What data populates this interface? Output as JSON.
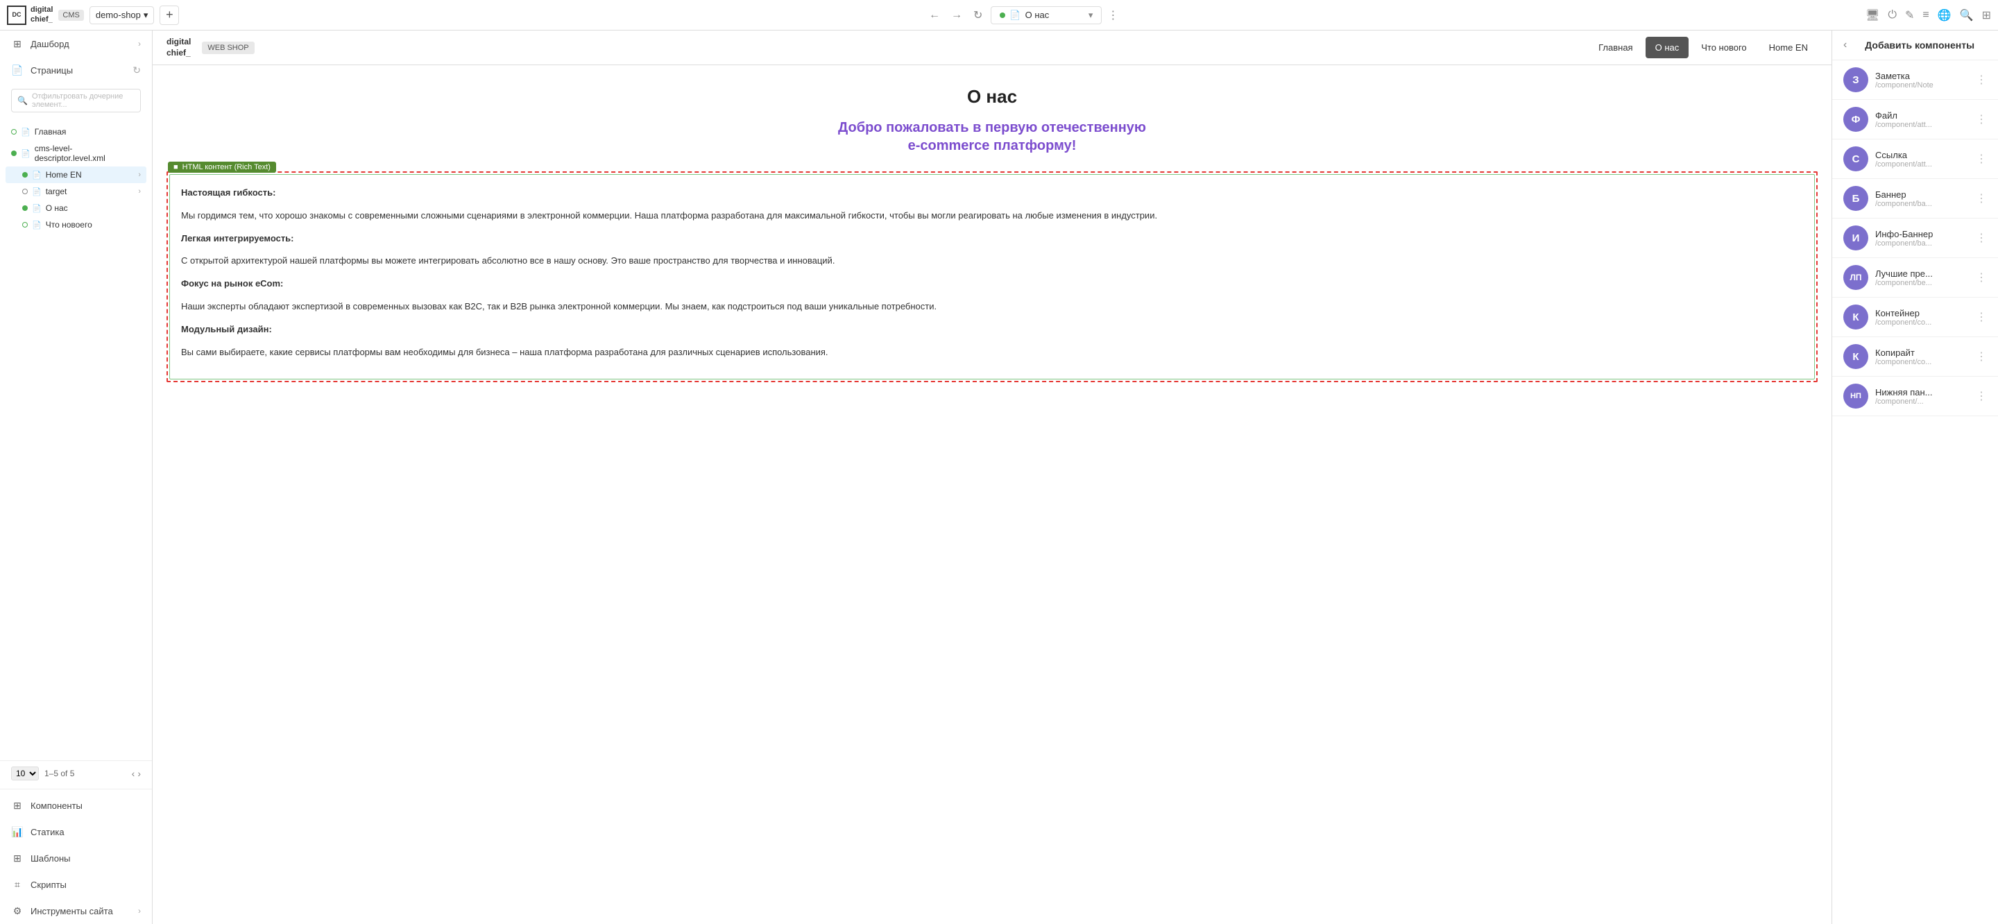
{
  "topbar": {
    "logo_line1": "digital",
    "logo_line2": "chief_",
    "cms_label": "CMS",
    "shop_name": "demo-shop",
    "add_btn_label": "+",
    "page_status_label": "О нас",
    "nav_icons": [
      "⏻",
      "✎",
      "≡",
      "🌐",
      "🔍",
      "⊞"
    ]
  },
  "left_sidebar": {
    "nav_items": [
      {
        "id": "dashboard",
        "icon": "⊞",
        "label": "Дашборд",
        "has_arrow": true
      },
      {
        "id": "pages",
        "icon": "📄",
        "label": "Страницы",
        "has_refresh": true
      }
    ],
    "filter_placeholder": "Отфильтровать дочерние элемент...",
    "tree": [
      {
        "id": "main",
        "type": "edit",
        "icon": "📄",
        "label": "Главная",
        "indent": 0,
        "selected": false
      },
      {
        "id": "cms-descriptor",
        "type": "green",
        "icon": "📄",
        "label": "cms-level-descriptor.level.xml",
        "indent": 0,
        "selected": false
      },
      {
        "id": "home-en",
        "type": "green",
        "icon": "📄",
        "label": "Home EN",
        "indent": 1,
        "has_arrow": true,
        "selected": true
      },
      {
        "id": "target",
        "type": "outline",
        "icon": "📄",
        "label": "target",
        "indent": 1,
        "has_arrow": true,
        "selected": false
      },
      {
        "id": "o-nas",
        "type": "green",
        "icon": "📄",
        "label": "О нас",
        "indent": 1,
        "selected": false
      },
      {
        "id": "chto-novogo",
        "type": "edit",
        "icon": "📄",
        "label": "Что новоего",
        "indent": 1,
        "selected": false
      }
    ],
    "pagination": {
      "per_page": "10",
      "range": "1–5 of 5"
    },
    "other_nav": [
      {
        "id": "components",
        "icon": "⊞",
        "label": "Компоненты"
      },
      {
        "id": "statika",
        "icon": "📊",
        "label": "Статика"
      },
      {
        "id": "shablony",
        "icon": "⊞",
        "label": "Шаблоны"
      },
      {
        "id": "skripty",
        "icon": "⌗",
        "label": "Скрипты"
      },
      {
        "id": "instrumenty",
        "icon": "⚙",
        "label": "Инструменты сайта",
        "has_arrow": true
      }
    ]
  },
  "preview": {
    "logo_line1": "digital",
    "logo_line2": "chief_",
    "web_shop_label": "WEB SHOP",
    "nav_links": [
      {
        "id": "glavnaya",
        "label": "Главная",
        "active": false
      },
      {
        "id": "o-nas",
        "label": "О нас",
        "active": true
      },
      {
        "id": "chto-novogo",
        "label": "Что нового",
        "active": false
      },
      {
        "id": "home-en",
        "label": "Home EN",
        "active": false
      }
    ],
    "page_title": "О нас",
    "subtitle_line1": "Добро пожаловать в первую отечественную",
    "subtitle_line2": "e-commerce платформу!",
    "component_tag": "HTML контент (Rich Text)",
    "content_blocks": [
      {
        "heading": "Настоящая гибкость:",
        "text": "Мы гордимся тем, что хорошо знакомы с современными сложными сценариями в электронной коммерции. Наша платформа разработана для максимальной гибкости, чтобы вы могли реагировать на любые изменения в индустрии."
      },
      {
        "heading": "Легкая интегрируемость:",
        "text": "С открытой архитектурой нашей платформы вы можете интегрировать абсолютно все в нашу основу. Это ваше пространство для творчества и инноваций."
      },
      {
        "heading": "Фокус на рынок eCom:",
        "text": "Наши эксперты обладают экспертизой в современных вызовах как B2C, так и B2B рынка электронной коммерции. Мы знаем, как подстроиться под ваши уникальные потребности."
      },
      {
        "heading": "Модульный дизайн:",
        "text": "Вы сами выбираете, какие сервисы платформы вам необходимы для бизнеса – наша платформа разработана для различных сценариев использования."
      }
    ]
  },
  "right_sidebar": {
    "back_icon": "‹",
    "title": "Добавить компоненты",
    "components": [
      {
        "id": "zametka",
        "initial": "З",
        "color": "#7c6fcd",
        "name": "Заметка",
        "path": "/component/Note"
      },
      {
        "id": "fayl",
        "initial": "Ф",
        "color": "#7c6fcd",
        "name": "Файл",
        "path": "/component/att..."
      },
      {
        "id": "ssylka",
        "initial": "С",
        "color": "#7c6fcd",
        "name": "Ссылка",
        "path": "/component/att..."
      },
      {
        "id": "banner",
        "initial": "Б",
        "color": "#7c6fcd",
        "name": "Баннер",
        "path": "/component/ba..."
      },
      {
        "id": "info-banner",
        "initial": "И",
        "color": "#7c6fcd",
        "name": "Инфо-Баннер",
        "path": "/component/ba..."
      },
      {
        "id": "luchshie-pre",
        "initial": "ЛП",
        "color": "#7c6fcd",
        "name": "Лучшие пре...",
        "path": "/component/be..."
      },
      {
        "id": "konteyner",
        "initial": "К",
        "color": "#7c6fcd",
        "name": "Контейнер",
        "path": "/component/co..."
      },
      {
        "id": "kopirayt",
        "initial": "К",
        "color": "#7c6fcd",
        "name": "Копирайт",
        "path": "/component/co..."
      },
      {
        "id": "nizhnyaya-pan",
        "initial": "НП",
        "color": "#7c6fcd",
        "name": "Нижняя пан...",
        "path": "/component/..."
      }
    ]
  }
}
